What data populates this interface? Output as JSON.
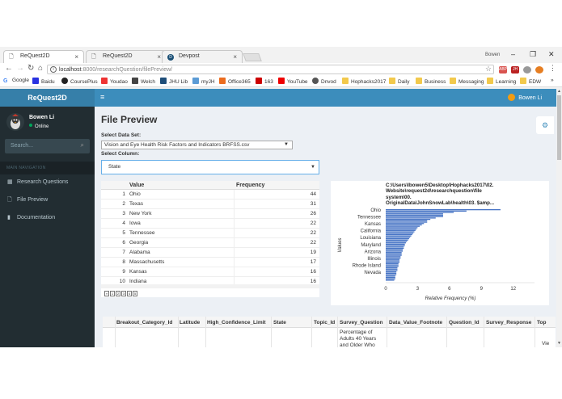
{
  "browser": {
    "tabs": [
      {
        "title": "ReQuest2D",
        "active": true
      },
      {
        "title": "ReQuest2D",
        "active": false
      },
      {
        "title": "Devpost",
        "active": false
      }
    ],
    "profile_name": "Bowen",
    "url_host": "localhost",
    "url_rest": ":8000/researchQuestion/filePreview/",
    "bookmarks": [
      "Google",
      "Baidu",
      "CoursePlus",
      "Youdao",
      "Welch",
      "JHU Lib",
      "myJH",
      "Office365",
      "163",
      "YouTube",
      "Dnvod",
      "Hophacks2017",
      "Daily",
      "Business",
      "Messaging",
      "Learning",
      "EDW"
    ],
    "more": "»"
  },
  "app": {
    "logo": "ReQuest2D",
    "user_name": "Bowen Li",
    "status": "Online",
    "search_placeholder": "Search...",
    "nav_header": "MAIN NAVIGATION",
    "nav": [
      {
        "label": "Research Questions",
        "icon": "table-icon"
      },
      {
        "label": "File Preview",
        "icon": "file-icon"
      },
      {
        "label": "Documentation",
        "icon": "book-icon"
      }
    ]
  },
  "page": {
    "title": "File Preview",
    "dataset_label": "Select Data Set:",
    "dataset_value": "Vision and Eye Health Risk Factors and Indicators BRFSS.csv",
    "column_label": "Select Column:",
    "column_value": "State"
  },
  "freq_table": {
    "headers": [
      "Value",
      "Frequency"
    ],
    "rows": [
      {
        "idx": "1",
        "value": "Ohio",
        "freq": "44"
      },
      {
        "idx": "2",
        "value": "Texas",
        "freq": "31"
      },
      {
        "idx": "3",
        "value": "New York",
        "freq": "26"
      },
      {
        "idx": "4",
        "value": "Iowa",
        "freq": "22"
      },
      {
        "idx": "5",
        "value": "Tennessee",
        "freq": "22"
      },
      {
        "idx": "6",
        "value": "Georgia",
        "freq": "22"
      },
      {
        "idx": "7",
        "value": "Alabama",
        "freq": "19"
      },
      {
        "idx": "8",
        "value": "Massachusetts",
        "freq": "17"
      },
      {
        "idx": "9",
        "value": "Kansas",
        "freq": "16"
      },
      {
        "idx": "10",
        "value": "Indiana",
        "freq": "16"
      }
    ],
    "pager": [
      "«",
      "1",
      "2",
      "3",
      "4",
      "5"
    ]
  },
  "chart_data": {
    "type": "bar",
    "orientation": "horizontal",
    "title": "C:\\Users\\lbowen5\\Desktop\\Hophacks2017\\02. Website\\request2d\\researchquestion\\file system\\00. OriginalData\\JohnSnowLab\\health\\03. $amp...",
    "title_lines": [
      "C:\\Users\\lbowen5\\Desktop\\Hophacks2017\\02.",
      "Website\\request2d\\researchquestion\\file",
      "system\\00.",
      "OriginalData\\JohnSnowLab\\health\\03. $amp..."
    ],
    "xlabel": "Relative Frequency (%)",
    "ylabel": "Values",
    "xlim": [
      0,
      14
    ],
    "xticks": [
      0,
      3,
      6,
      9,
      12
    ],
    "labeled_categories": [
      "Ohio",
      "Tennessee",
      "Kansas",
      "California",
      "Louisiana",
      "Maryland",
      "Arizona",
      "Illinois",
      "Rhode Island",
      "Nevada"
    ],
    "values": [
      10.8,
      7.6,
      6.4,
      5.4,
      5.4,
      5.4,
      4.7,
      4.2,
      3.9,
      3.9,
      3.6,
      3.4,
      3.2,
      3.0,
      2.9,
      2.8,
      2.7,
      2.6,
      2.5,
      2.4,
      2.3,
      2.2,
      2.1,
      2.0,
      1.9,
      1.8,
      1.8,
      1.7,
      1.7,
      1.6,
      1.6,
      1.5,
      1.5,
      1.5,
      1.4,
      1.4,
      1.3,
      1.3,
      1.3,
      1.2,
      1.2,
      1.2,
      1.1,
      1.1,
      1.1,
      1.0,
      1.0,
      1.0,
      0.9,
      0.9,
      0.9,
      0.8
    ],
    "bar_color": "#4472c4",
    "grid": false
  },
  "wide_table": {
    "columns": [
      "Breakout_Category_Id",
      "Latitude",
      "High_Confidence_Limit",
      "State",
      "Topic_Id",
      "Survey_Question",
      "Data_Value_Footnote",
      "Question_Id",
      "Survey_Response",
      "Top"
    ],
    "first_cell": [
      "Percentage of",
      "Adults 40 Years",
      "and Older Who"
    ],
    "survey_response_partial": "Vie"
  }
}
